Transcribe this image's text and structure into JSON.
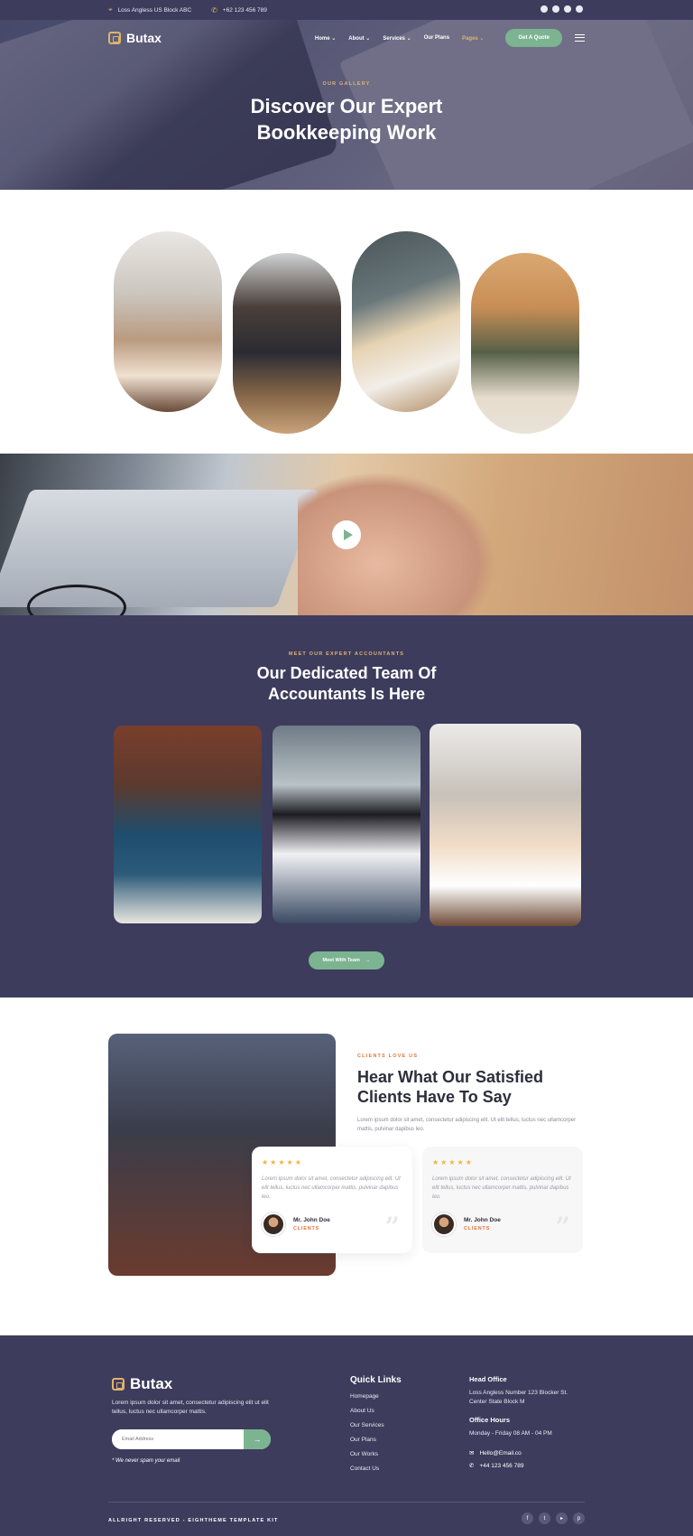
{
  "topbar": {
    "address": "Loss Angless US Block ABC",
    "phone": "+62 123 456 789",
    "socials": [
      "facebook-icon",
      "twitter-icon",
      "youtube-icon",
      "pinterest-icon"
    ]
  },
  "nav": {
    "brand": "Butax",
    "items": [
      {
        "label": "Home ⌄"
      },
      {
        "label": "About ⌄"
      },
      {
        "label": "Services ⌄"
      },
      {
        "label": "Our Plans"
      },
      {
        "label": "Pages ⌄"
      }
    ],
    "cta": "Get A Quote"
  },
  "hero": {
    "eyebrow": "OUR GALLERY",
    "title_line1": "Discover Our Expert",
    "title_line2": "Bookkeeping Work"
  },
  "team": {
    "eyebrow": "MEET OUR EXPERT ACCOUNTANTS",
    "title_line1": "Our Dedicated Team Of",
    "title_line2": "Accountants Is Here",
    "button": "Meet With Team"
  },
  "testimonials": {
    "eyebrow": "CLIENTS LOVE US",
    "title_line1": "Hear What Our Satisfied",
    "title_line2": "Clients Have To Say",
    "description": "Lorem ipsum dolor sit amet, consectetur adipiscing elit. Ut elit tellus, luctus nec ullamcorper mattis, pulvinar dapibus leo.",
    "cards": [
      {
        "stars": "★★★★★",
        "text": "Lorem ipsum dolor sit amet, consectetur adipiscing elit. Ut elit tellus, luctus nec ullamcorper mattis, pulvinar dapibus leo.",
        "name": "Mr. John Doe",
        "role": "CLIENTS"
      },
      {
        "stars": "★★★★★",
        "text": "Lorem ipsum dolor sit amet, consectetur adipiscing elit. Ut elit tellus, luctus nec ullamcorper mattis, pulvinar dapibus leo.",
        "name": "Mr. John Doe",
        "role": "CLIENTS"
      }
    ]
  },
  "footer": {
    "brand": "Butax",
    "description": "Lorem ipsum dolor sit amet, consectetur adipiscing elit ut elit tellus, luctus nec ullamcorper mattis.",
    "email_placeholder": "Email Address",
    "note": "* We never spam your email",
    "quick_links_title": "Quick Links",
    "quick_links": [
      "Homepage",
      "About Us",
      "Our Services",
      "Our Plans",
      "Our Works",
      "Contact Us"
    ],
    "head_office_title": "Head Office",
    "head_office_address": "Loss Angless Number 123 Blocker St. Center State Block M",
    "office_hours_title": "Office Hours",
    "office_hours": "Monday - Friday 08 AM - 04 PM",
    "email": "Hello@Email.co",
    "phone": "+44 123 456 789",
    "copyright": "ALLRIGHT RESERVED - EIGHTHEME TEMPLATE KIT"
  },
  "colors": {
    "navy": "#3d3c5d",
    "accent_green": "#7cb491",
    "accent_gold": "#e0b36a",
    "accent_orange": "#e0763a",
    "star": "#f2b43b"
  }
}
